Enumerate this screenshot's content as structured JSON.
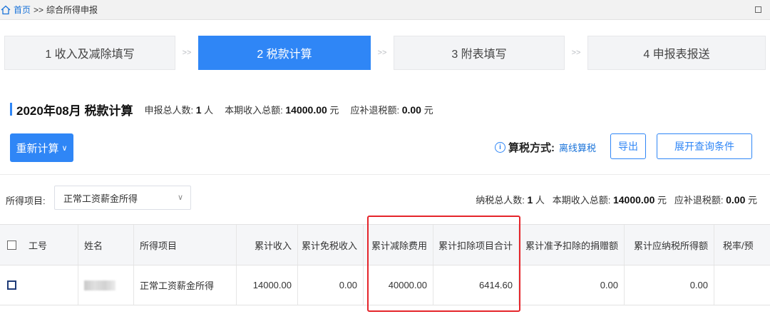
{
  "breadcrumb": {
    "home": "首页",
    "separator": ">>",
    "current": "综合所得申报"
  },
  "steps": [
    {
      "label": "1 收入及减除填写",
      "active": false
    },
    {
      "label": "2 税款计算",
      "active": true
    },
    {
      "label": "3 附表填写",
      "active": false
    },
    {
      "label": "4 申报表报送",
      "active": false
    }
  ],
  "step_separator": ">>",
  "header": {
    "title": "2020年08月 税款计算",
    "total_people_label": "申报总人数:",
    "total_people_value": "1",
    "total_people_unit": "人",
    "income_label": "本期收入总额:",
    "income_value": "14000.00",
    "income_unit": "元",
    "refund_label": "应补退税额:",
    "refund_value": "0.00",
    "refund_unit": "元"
  },
  "toolbar": {
    "recalc_label": "重新计算",
    "calc_mode_label": "算税方式:",
    "calc_mode_value": "离线算税",
    "export_label": "导出",
    "expand_label": "展开查询条件"
  },
  "filter": {
    "label": "所得项目:",
    "selected": "正常工资薪金所得"
  },
  "summary": {
    "tax_people_label": "纳税总人数:",
    "tax_people_value": "1",
    "tax_people_unit": "人",
    "income_label": "本期收入总额:",
    "income_value": "14000.00",
    "income_unit": "元",
    "refund_label": "应补退税额:",
    "refund_value": "0.00",
    "refund_unit": "元"
  },
  "table": {
    "columns": [
      "工号",
      "姓名",
      "所得项目",
      "累计收入",
      "累计免税收入",
      "累计减除费用",
      "累计扣除项目合计",
      "累计准予扣除的捐赠额",
      "累计应纳税所得额",
      "税率/预"
    ],
    "rows": [
      {
        "employee_id": "",
        "name": "",
        "income_item": "正常工资薪金所得",
        "cum_income": "14000.00",
        "cum_tax_free": "0.00",
        "cum_deduction_fee": "40000.00",
        "cum_deduction_total": "6414.60",
        "cum_donation": "0.00",
        "cum_taxable": "0.00"
      }
    ]
  },
  "colors": {
    "primary": "#2f86f6",
    "highlight": "#e5252b",
    "link": "#1a73d9"
  }
}
